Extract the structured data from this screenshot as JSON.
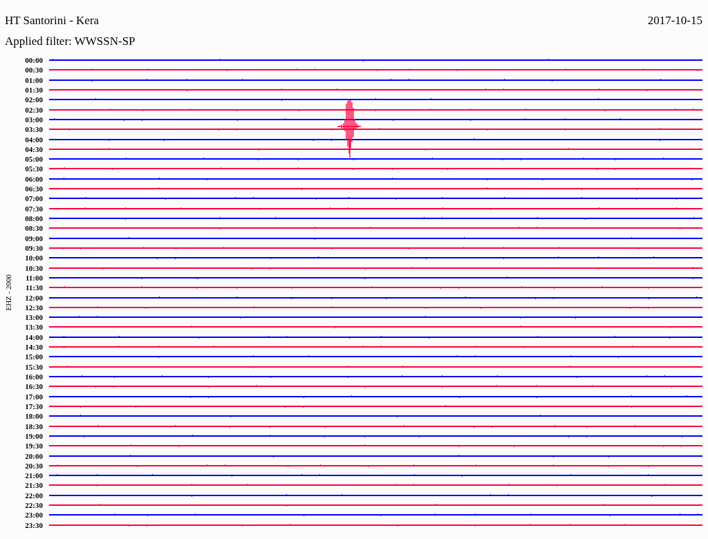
{
  "header": {
    "title": "HT Santorini - Kera",
    "date": "2017-10-15",
    "filter": "Applied filter: WWSSN-SP"
  },
  "channel_label": "EHZ - 2000",
  "rows": [
    {
      "time": "00:00",
      "color": "#0000ff"
    },
    {
      "time": "00:30",
      "color": "#ff0040"
    },
    {
      "time": "01:00",
      "color": "#0000ff"
    },
    {
      "time": "01:30",
      "color": "#ff0040"
    },
    {
      "time": "02:00",
      "color": "#0000ff"
    },
    {
      "time": "02:30",
      "color": "#ff0040"
    },
    {
      "time": "03:00",
      "color": "#0000ff"
    },
    {
      "time": "03:30",
      "color": "#ff0040"
    },
    {
      "time": "04:00",
      "color": "#0000ff"
    },
    {
      "time": "04:30",
      "color": "#ff0040"
    },
    {
      "time": "05:00",
      "color": "#0000ff"
    },
    {
      "time": "05:30",
      "color": "#ff0040"
    },
    {
      "time": "06:00",
      "color": "#0000ff"
    },
    {
      "time": "06:30",
      "color": "#ff0040"
    },
    {
      "time": "07:00",
      "color": "#0000ff"
    },
    {
      "time": "07:30",
      "color": "#ff0040"
    },
    {
      "time": "08:00",
      "color": "#0000ff"
    },
    {
      "time": "08:30",
      "color": "#ff0040"
    },
    {
      "time": "09:00",
      "color": "#0000ff"
    },
    {
      "time": "09:30",
      "color": "#ff0040"
    },
    {
      "time": "10:00",
      "color": "#0000ff"
    },
    {
      "time": "10:30",
      "color": "#ff0040"
    },
    {
      "time": "11:00",
      "color": "#0000ff"
    },
    {
      "time": "11:30",
      "color": "#ff0040"
    },
    {
      "time": "12:00",
      "color": "#0000ff"
    },
    {
      "time": "12:30",
      "color": "#ff0040"
    },
    {
      "time": "13:00",
      "color": "#0000ff"
    },
    {
      "time": "13:30",
      "color": "#ff0040"
    },
    {
      "time": "14:00",
      "color": "#0000ff"
    },
    {
      "time": "14:30",
      "color": "#ff0040"
    },
    {
      "time": "15:00",
      "color": "#0000ff"
    },
    {
      "time": "15:30",
      "color": "#ff0040"
    },
    {
      "time": "16:00",
      "color": "#0000ff"
    },
    {
      "time": "16:30",
      "color": "#ff0040"
    },
    {
      "time": "17:00",
      "color": "#0000ff"
    },
    {
      "time": "17:30",
      "color": "#ff0040"
    },
    {
      "time": "18:00",
      "color": "#0000ff"
    },
    {
      "time": "18:30",
      "color": "#ff0040"
    },
    {
      "time": "19:00",
      "color": "#0000ff"
    },
    {
      "time": "19:30",
      "color": "#ff0040"
    },
    {
      "time": "20:00",
      "color": "#0000ff"
    },
    {
      "time": "20:30",
      "color": "#ff0040"
    },
    {
      "time": "21:00",
      "color": "#0000ff"
    },
    {
      "time": "21:30",
      "color": "#ff0040"
    },
    {
      "time": "22:00",
      "color": "#0000ff"
    },
    {
      "time": "22:30",
      "color": "#ff0040"
    },
    {
      "time": "23:00",
      "color": "#0000ff"
    },
    {
      "time": "23:30",
      "color": "#ff0040"
    }
  ]
}
